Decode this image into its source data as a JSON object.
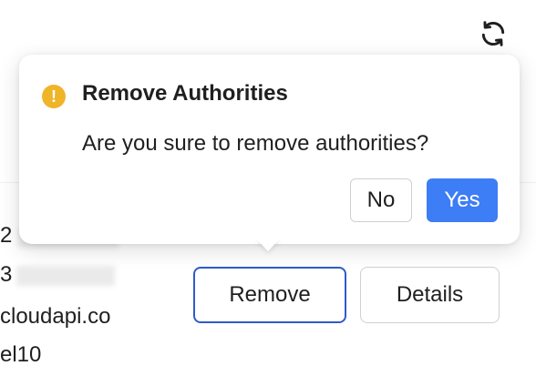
{
  "toolbar": {
    "refresh_icon": "refresh-icon"
  },
  "table": {
    "rows": [
      {
        "text": "2"
      },
      {
        "text": "3"
      },
      {
        "text": "cloudapi.co"
      },
      {
        "text": "el10"
      }
    ],
    "actions": {
      "remove_label": "Remove",
      "details_label": "Details"
    }
  },
  "popconfirm": {
    "icon": "exclamation-icon",
    "icon_glyph": "!",
    "title": "Remove Authorities",
    "description": "Are you sure to remove authorities?",
    "cancel_label": "No",
    "confirm_label": "Yes",
    "colors": {
      "warning": "#f0b429",
      "primary": "#3d7df5",
      "focus_border": "#2f5bc9"
    }
  }
}
